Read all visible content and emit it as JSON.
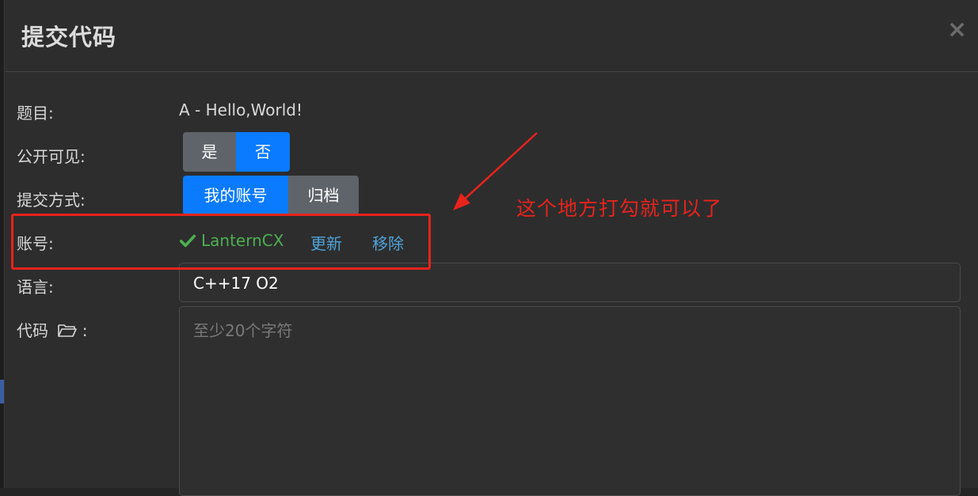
{
  "modal": {
    "title": "提交代码",
    "close_label": "×"
  },
  "form": {
    "problem_label": "题目:",
    "problem_value": "A - Hello,World!",
    "visibility_label": "公开可见:",
    "visibility_options": [
      "是",
      "否"
    ],
    "visibility_selected": "否",
    "submit_method_label": "提交方式:",
    "submit_method_options": [
      "我的账号",
      "归档"
    ],
    "submit_method_selected": "我的账号",
    "account_label": "账号:",
    "account_name": "LanternCX",
    "account_verified": true,
    "update_link": "更新",
    "remove_link": "移除",
    "language_label": "语言:",
    "language_value": "C++17 O2",
    "code_label": "代码",
    "code_label_suffix": ":",
    "code_placeholder": "至少20个字符"
  },
  "annotation": {
    "text": "这个地方打勾就可以了",
    "color": "#e8231d"
  },
  "colors": {
    "primary": "#0a7bff",
    "secondary": "#5f646a",
    "success": "#4caf50",
    "link": "#4fa3d9"
  }
}
